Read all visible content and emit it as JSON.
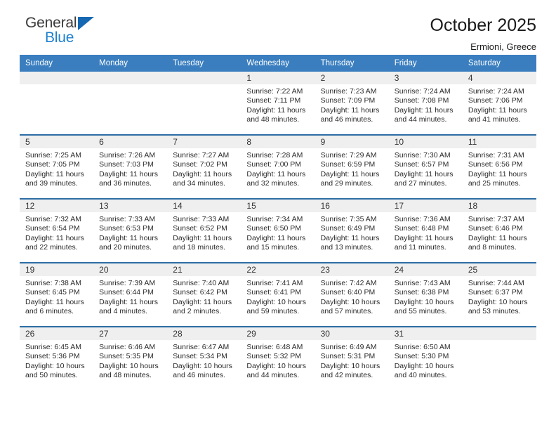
{
  "brand": {
    "name_top": "General",
    "name_bottom": "Blue",
    "triangle_color": "#1668b3",
    "blue_text_color": "#1f80d0"
  },
  "header": {
    "title": "October 2025",
    "subtitle": "Ermioni, Greece"
  },
  "theme": {
    "header_row_bg": "#3a7ebf",
    "row_divider": "#2e6da4",
    "daynum_bg": "#efefef",
    "page_bg": "#ffffff"
  },
  "weekdays": [
    "Sunday",
    "Monday",
    "Tuesday",
    "Wednesday",
    "Thursday",
    "Friday",
    "Saturday"
  ],
  "labels": {
    "sunrise_prefix": "Sunrise:",
    "sunset_prefix": "Sunset:",
    "daylight_prefix": "Daylight:"
  },
  "weeks": [
    [
      {
        "day": "",
        "empty": true
      },
      {
        "day": "",
        "empty": true
      },
      {
        "day": "",
        "empty": true
      },
      {
        "day": "1",
        "sunrise": "Sunrise: 7:22 AM",
        "sunset": "Sunset: 7:11 PM",
        "daylight1": "Daylight: 11 hours",
        "daylight2": "and 48 minutes."
      },
      {
        "day": "2",
        "sunrise": "Sunrise: 7:23 AM",
        "sunset": "Sunset: 7:09 PM",
        "daylight1": "Daylight: 11 hours",
        "daylight2": "and 46 minutes."
      },
      {
        "day": "3",
        "sunrise": "Sunrise: 7:24 AM",
        "sunset": "Sunset: 7:08 PM",
        "daylight1": "Daylight: 11 hours",
        "daylight2": "and 44 minutes."
      },
      {
        "day": "4",
        "sunrise": "Sunrise: 7:24 AM",
        "sunset": "Sunset: 7:06 PM",
        "daylight1": "Daylight: 11 hours",
        "daylight2": "and 41 minutes."
      }
    ],
    [
      {
        "day": "5",
        "sunrise": "Sunrise: 7:25 AM",
        "sunset": "Sunset: 7:05 PM",
        "daylight1": "Daylight: 11 hours",
        "daylight2": "and 39 minutes."
      },
      {
        "day": "6",
        "sunrise": "Sunrise: 7:26 AM",
        "sunset": "Sunset: 7:03 PM",
        "daylight1": "Daylight: 11 hours",
        "daylight2": "and 36 minutes."
      },
      {
        "day": "7",
        "sunrise": "Sunrise: 7:27 AM",
        "sunset": "Sunset: 7:02 PM",
        "daylight1": "Daylight: 11 hours",
        "daylight2": "and 34 minutes."
      },
      {
        "day": "8",
        "sunrise": "Sunrise: 7:28 AM",
        "sunset": "Sunset: 7:00 PM",
        "daylight1": "Daylight: 11 hours",
        "daylight2": "and 32 minutes."
      },
      {
        "day": "9",
        "sunrise": "Sunrise: 7:29 AM",
        "sunset": "Sunset: 6:59 PM",
        "daylight1": "Daylight: 11 hours",
        "daylight2": "and 29 minutes."
      },
      {
        "day": "10",
        "sunrise": "Sunrise: 7:30 AM",
        "sunset": "Sunset: 6:57 PM",
        "daylight1": "Daylight: 11 hours",
        "daylight2": "and 27 minutes."
      },
      {
        "day": "11",
        "sunrise": "Sunrise: 7:31 AM",
        "sunset": "Sunset: 6:56 PM",
        "daylight1": "Daylight: 11 hours",
        "daylight2": "and 25 minutes."
      }
    ],
    [
      {
        "day": "12",
        "sunrise": "Sunrise: 7:32 AM",
        "sunset": "Sunset: 6:54 PM",
        "daylight1": "Daylight: 11 hours",
        "daylight2": "and 22 minutes."
      },
      {
        "day": "13",
        "sunrise": "Sunrise: 7:33 AM",
        "sunset": "Sunset: 6:53 PM",
        "daylight1": "Daylight: 11 hours",
        "daylight2": "and 20 minutes."
      },
      {
        "day": "14",
        "sunrise": "Sunrise: 7:33 AM",
        "sunset": "Sunset: 6:52 PM",
        "daylight1": "Daylight: 11 hours",
        "daylight2": "and 18 minutes."
      },
      {
        "day": "15",
        "sunrise": "Sunrise: 7:34 AM",
        "sunset": "Sunset: 6:50 PM",
        "daylight1": "Daylight: 11 hours",
        "daylight2": "and 15 minutes."
      },
      {
        "day": "16",
        "sunrise": "Sunrise: 7:35 AM",
        "sunset": "Sunset: 6:49 PM",
        "daylight1": "Daylight: 11 hours",
        "daylight2": "and 13 minutes."
      },
      {
        "day": "17",
        "sunrise": "Sunrise: 7:36 AM",
        "sunset": "Sunset: 6:48 PM",
        "daylight1": "Daylight: 11 hours",
        "daylight2": "and 11 minutes."
      },
      {
        "day": "18",
        "sunrise": "Sunrise: 7:37 AM",
        "sunset": "Sunset: 6:46 PM",
        "daylight1": "Daylight: 11 hours",
        "daylight2": "and 8 minutes."
      }
    ],
    [
      {
        "day": "19",
        "sunrise": "Sunrise: 7:38 AM",
        "sunset": "Sunset: 6:45 PM",
        "daylight1": "Daylight: 11 hours",
        "daylight2": "and 6 minutes."
      },
      {
        "day": "20",
        "sunrise": "Sunrise: 7:39 AM",
        "sunset": "Sunset: 6:44 PM",
        "daylight1": "Daylight: 11 hours",
        "daylight2": "and 4 minutes."
      },
      {
        "day": "21",
        "sunrise": "Sunrise: 7:40 AM",
        "sunset": "Sunset: 6:42 PM",
        "daylight1": "Daylight: 11 hours",
        "daylight2": "and 2 minutes."
      },
      {
        "day": "22",
        "sunrise": "Sunrise: 7:41 AM",
        "sunset": "Sunset: 6:41 PM",
        "daylight1": "Daylight: 10 hours",
        "daylight2": "and 59 minutes."
      },
      {
        "day": "23",
        "sunrise": "Sunrise: 7:42 AM",
        "sunset": "Sunset: 6:40 PM",
        "daylight1": "Daylight: 10 hours",
        "daylight2": "and 57 minutes."
      },
      {
        "day": "24",
        "sunrise": "Sunrise: 7:43 AM",
        "sunset": "Sunset: 6:38 PM",
        "daylight1": "Daylight: 10 hours",
        "daylight2": "and 55 minutes."
      },
      {
        "day": "25",
        "sunrise": "Sunrise: 7:44 AM",
        "sunset": "Sunset: 6:37 PM",
        "daylight1": "Daylight: 10 hours",
        "daylight2": "and 53 minutes."
      }
    ],
    [
      {
        "day": "26",
        "sunrise": "Sunrise: 6:45 AM",
        "sunset": "Sunset: 5:36 PM",
        "daylight1": "Daylight: 10 hours",
        "daylight2": "and 50 minutes."
      },
      {
        "day": "27",
        "sunrise": "Sunrise: 6:46 AM",
        "sunset": "Sunset: 5:35 PM",
        "daylight1": "Daylight: 10 hours",
        "daylight2": "and 48 minutes."
      },
      {
        "day": "28",
        "sunrise": "Sunrise: 6:47 AM",
        "sunset": "Sunset: 5:34 PM",
        "daylight1": "Daylight: 10 hours",
        "daylight2": "and 46 minutes."
      },
      {
        "day": "29",
        "sunrise": "Sunrise: 6:48 AM",
        "sunset": "Sunset: 5:32 PM",
        "daylight1": "Daylight: 10 hours",
        "daylight2": "and 44 minutes."
      },
      {
        "day": "30",
        "sunrise": "Sunrise: 6:49 AM",
        "sunset": "Sunset: 5:31 PM",
        "daylight1": "Daylight: 10 hours",
        "daylight2": "and 42 minutes."
      },
      {
        "day": "31",
        "sunrise": "Sunrise: 6:50 AM",
        "sunset": "Sunset: 5:30 PM",
        "daylight1": "Daylight: 10 hours",
        "daylight2": "and 40 minutes."
      },
      {
        "day": "",
        "empty": true
      }
    ]
  ]
}
